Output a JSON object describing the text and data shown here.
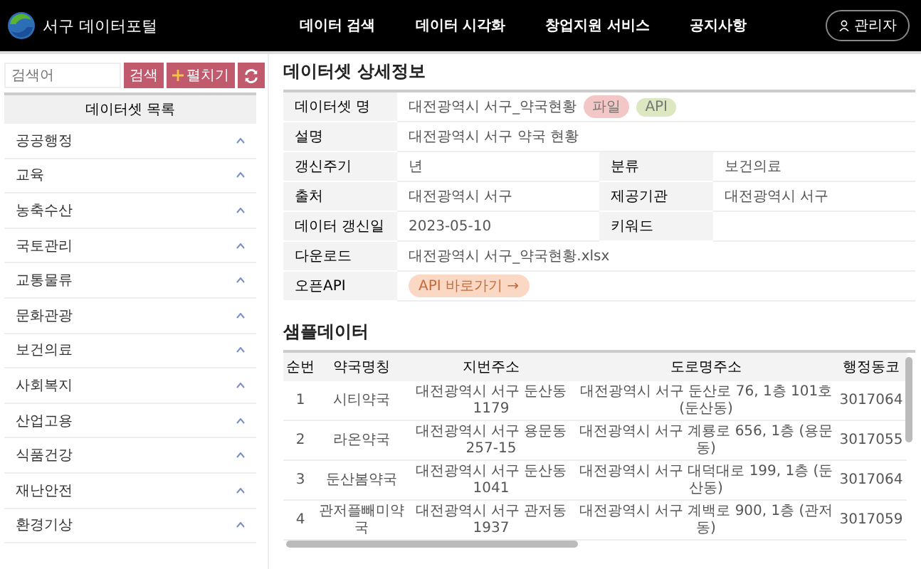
{
  "header": {
    "logo_text": "서구 데이터포털",
    "nav": [
      "데이터 검색",
      "데이터 시각화",
      "창업지원 서비스",
      "공지사항"
    ],
    "admin_button": "관리자"
  },
  "sidebar": {
    "search": {
      "placeholder": "검색어"
    },
    "search_button": "검색",
    "expand_button": "펼치기",
    "list_title": "데이터셋 목록",
    "items": [
      {
        "label": "공공행정",
        "expanded": false
      },
      {
        "label": "교육",
        "expanded": false
      },
      {
        "label": "농축수산",
        "expanded": false
      },
      {
        "label": "국토관리",
        "expanded": false
      },
      {
        "label": "교통물류",
        "expanded": false
      },
      {
        "label": "문화관광",
        "expanded": false
      },
      {
        "label": "보건의료",
        "expanded": false
      },
      {
        "label": "사회복지",
        "expanded": false
      },
      {
        "label": "산업고용",
        "expanded": false
      },
      {
        "label": "식품건강",
        "expanded": false
      },
      {
        "label": "재난안전",
        "expanded": false
      },
      {
        "label": "환경기상",
        "expanded": false
      }
    ]
  },
  "detail": {
    "title": "데이터셋 상세정보",
    "rows": [
      {
        "cells": [
          {
            "label": "데이터셋 명",
            "value": "대전광역시 서구_약국현황",
            "badges": [
              {
                "text": "파일",
                "color": "#f4c7c7"
              },
              {
                "text": "API",
                "color": "#dde8c2"
              }
            ]
          }
        ]
      },
      {
        "cells": [
          {
            "label": "설명",
            "value": "대전광역시 서구 약국 현황"
          }
        ]
      },
      {
        "cells": [
          {
            "label": "갱신주기",
            "value": "년"
          },
          {
            "label": "분류",
            "value": "보건의료"
          }
        ]
      },
      {
        "cells": [
          {
            "label": "출처",
            "value": "대전광역시 서구"
          },
          {
            "label": "제공기관",
            "value": "대전광역시 서구"
          }
        ]
      },
      {
        "cells": [
          {
            "label": "데이터 갱신일",
            "value": "2023-05-10"
          },
          {
            "label": "키워드"
          }
        ]
      },
      {
        "cells": [
          {
            "label": "다운로드",
            "value": "대전광역시 서구_약국현황.xlsx"
          }
        ]
      },
      {
        "cells": [
          {
            "label": "오픈API",
            "button": "API 바로가기 →"
          }
        ]
      }
    ]
  },
  "sample": {
    "title": "샘플데이터",
    "columns": [
      "순번",
      "약국명칭",
      "지번주소",
      "도로명주소",
      "행정동코"
    ],
    "rows": [
      [
        "1",
        "시티약국",
        "대전광역시 서구 둔산동 1179",
        "대전광역시 서구 둔산로 76, 1층 101호 (둔산동)",
        "3017064"
      ],
      [
        "2",
        "라온약국",
        "대전광역시 서구 용문동 257-15",
        "대전광역시 서구 계룡로 656, 1층 (용문동)",
        "3017055"
      ],
      [
        "3",
        "둔산봄약국",
        "대전광역시 서구 둔산동 1041",
        "대전광역시 서구 대덕대로 199, 1층 (둔산동)",
        "3017064"
      ],
      [
        "4",
        "관저플빼미약국",
        "대전광역시 서구 관저동 1937",
        "대전광역시 서구 계백로 900, 1층 (관저동)",
        "3017059"
      ]
    ]
  }
}
